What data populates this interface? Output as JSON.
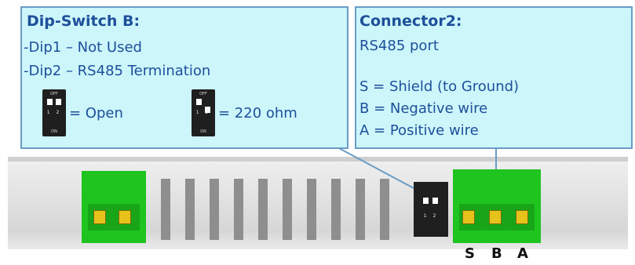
{
  "dipswitch": {
    "title": "Dip-Switch B:",
    "lines": [
      "-Dip1 – Not Used",
      "-Dip2 – RS485 Termination"
    ],
    "options": [
      {
        "label": "= Open"
      },
      {
        "label": "= 220 ohm"
      }
    ],
    "icon_top_text": "OFF",
    "icon_numbers": "1 2",
    "icon_bottom_text": "ON"
  },
  "connector": {
    "title": "Connector2:",
    "subtitle": "RS485 port",
    "pins": [
      "S = Shield (to Ground)",
      "B = Negative wire",
      "A = Positive wire"
    ]
  },
  "pin_labels": [
    "S",
    "B",
    "A"
  ],
  "colors": {
    "callout_bg": "#ccf6fa",
    "callout_border": "#6a9cc4",
    "text": "#1e4f9a",
    "terminal_green": "#1fc41f",
    "screw_yellow": "#e6c21a"
  }
}
